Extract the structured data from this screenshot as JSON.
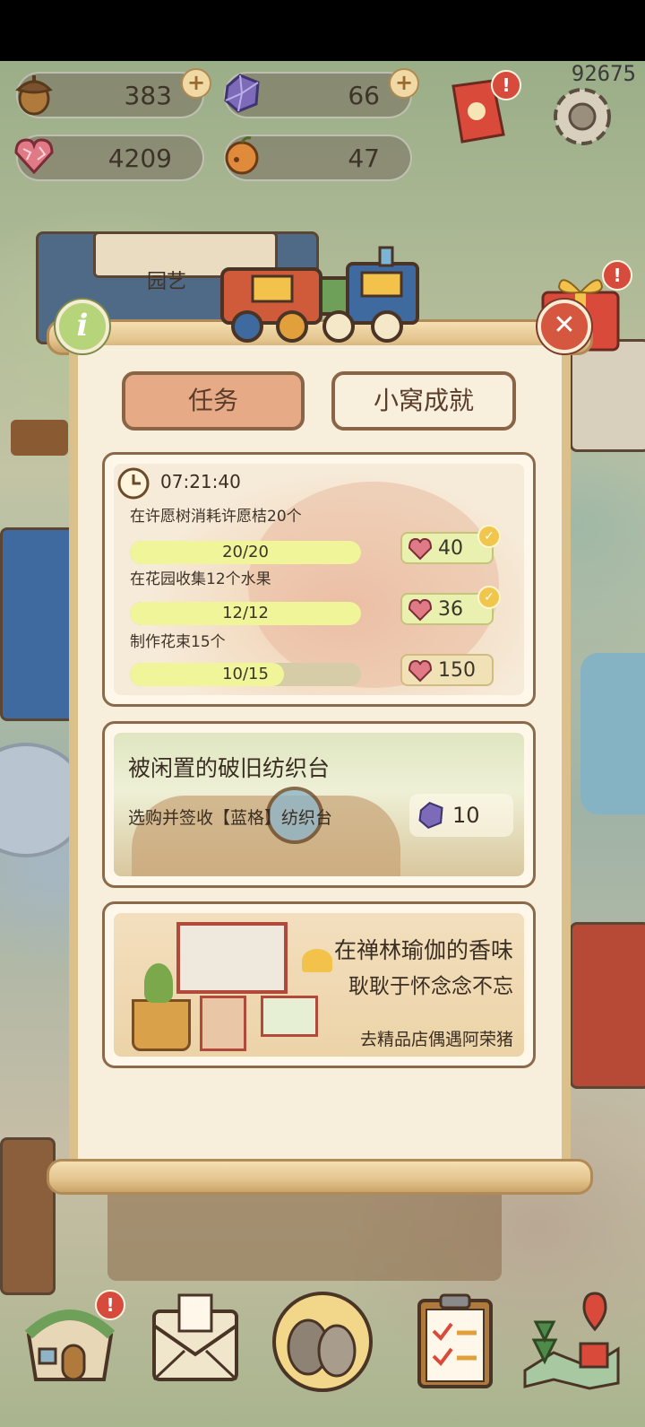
{
  "status": {
    "resources": [
      {
        "value": "383",
        "icon": "acorn-icon"
      },
      {
        "value": "66",
        "icon": "purple-gem-icon"
      },
      {
        "value": "4209",
        "icon": "heart-crystal-icon"
      },
      {
        "value": "47",
        "icon": "orange-fruit-icon"
      }
    ],
    "counter": "92675"
  },
  "scene": {
    "shop_sign": "园艺"
  },
  "panel": {
    "tabs": [
      {
        "label": "任务",
        "active": true
      },
      {
        "label": "小窝成就",
        "active": false
      }
    ],
    "daily": {
      "timer": "07:21:40",
      "tasks": [
        {
          "text": "在许愿树消耗许愿桔20个",
          "progress": "20/20",
          "fraction": 1.0,
          "reward": "40",
          "claimed": true
        },
        {
          "text": "在花园收集12个水果",
          "progress": "12/12",
          "fraction": 1.0,
          "reward": "36",
          "claimed": true
        },
        {
          "text": "制作花束15个",
          "progress": "10/15",
          "fraction": 0.667,
          "reward": "150",
          "claimed": false
        }
      ]
    },
    "quest1": {
      "title": "被闲置的破旧纺织台",
      "desc": "选购并签收【蓝格】纺织台",
      "reward": "10"
    },
    "quest2": {
      "line1": "在禅林瑜伽的香味",
      "line2": "耿耿于怀念念不忘",
      "hint": "去精品店偶遇阿荣猪"
    }
  },
  "nav": {
    "items": [
      {
        "name": "home-nav-button",
        "icon": "cottage-icon",
        "badge": "!"
      },
      {
        "name": "mail-nav-button",
        "icon": "envelope-icon",
        "badge": ""
      },
      {
        "name": "friends-nav-button",
        "icon": "birds-icon",
        "badge": ""
      },
      {
        "name": "tasks-nav-button",
        "icon": "clipboard-icon",
        "badge": ""
      },
      {
        "name": "map-nav-button",
        "icon": "map-icon",
        "badge": ""
      }
    ]
  },
  "colors": {
    "accent_tab": "#e6aa86",
    "progress_fill": "#f1f59a",
    "badge": "#d64b3c"
  }
}
